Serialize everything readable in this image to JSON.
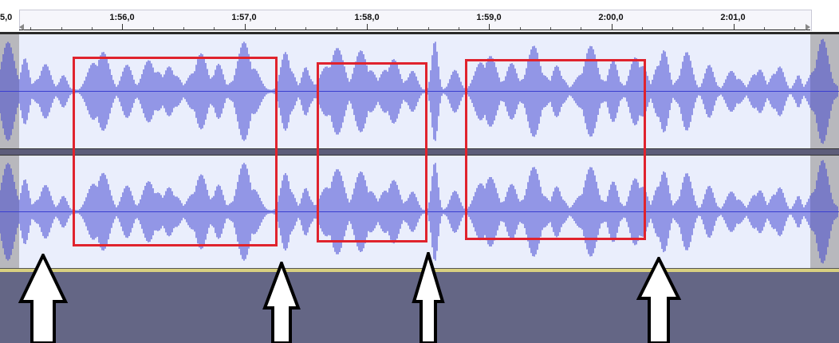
{
  "timeline": {
    "labels": [
      "5,0",
      "1:56,0",
      "1:57,0",
      "1:58,0",
      "1:59,0",
      "2:00,0",
      "2:01,0"
    ]
  },
  "colors": {
    "waveform": "#3b3fd0",
    "track_bg": "#eaeefc",
    "selection_box": "#e0232d",
    "background": "#646685",
    "arrow_fill": "#ffffff",
    "arrow_stroke": "#000000"
  },
  "track": {
    "channels": [
      "left-channel",
      "right-channel"
    ]
  },
  "annotations": {
    "boxes": [
      "box-1",
      "box-2",
      "box-3"
    ],
    "arrows": [
      "up-arrow-1",
      "up-arrow-2",
      "up-arrow-3",
      "up-arrow-4"
    ]
  }
}
